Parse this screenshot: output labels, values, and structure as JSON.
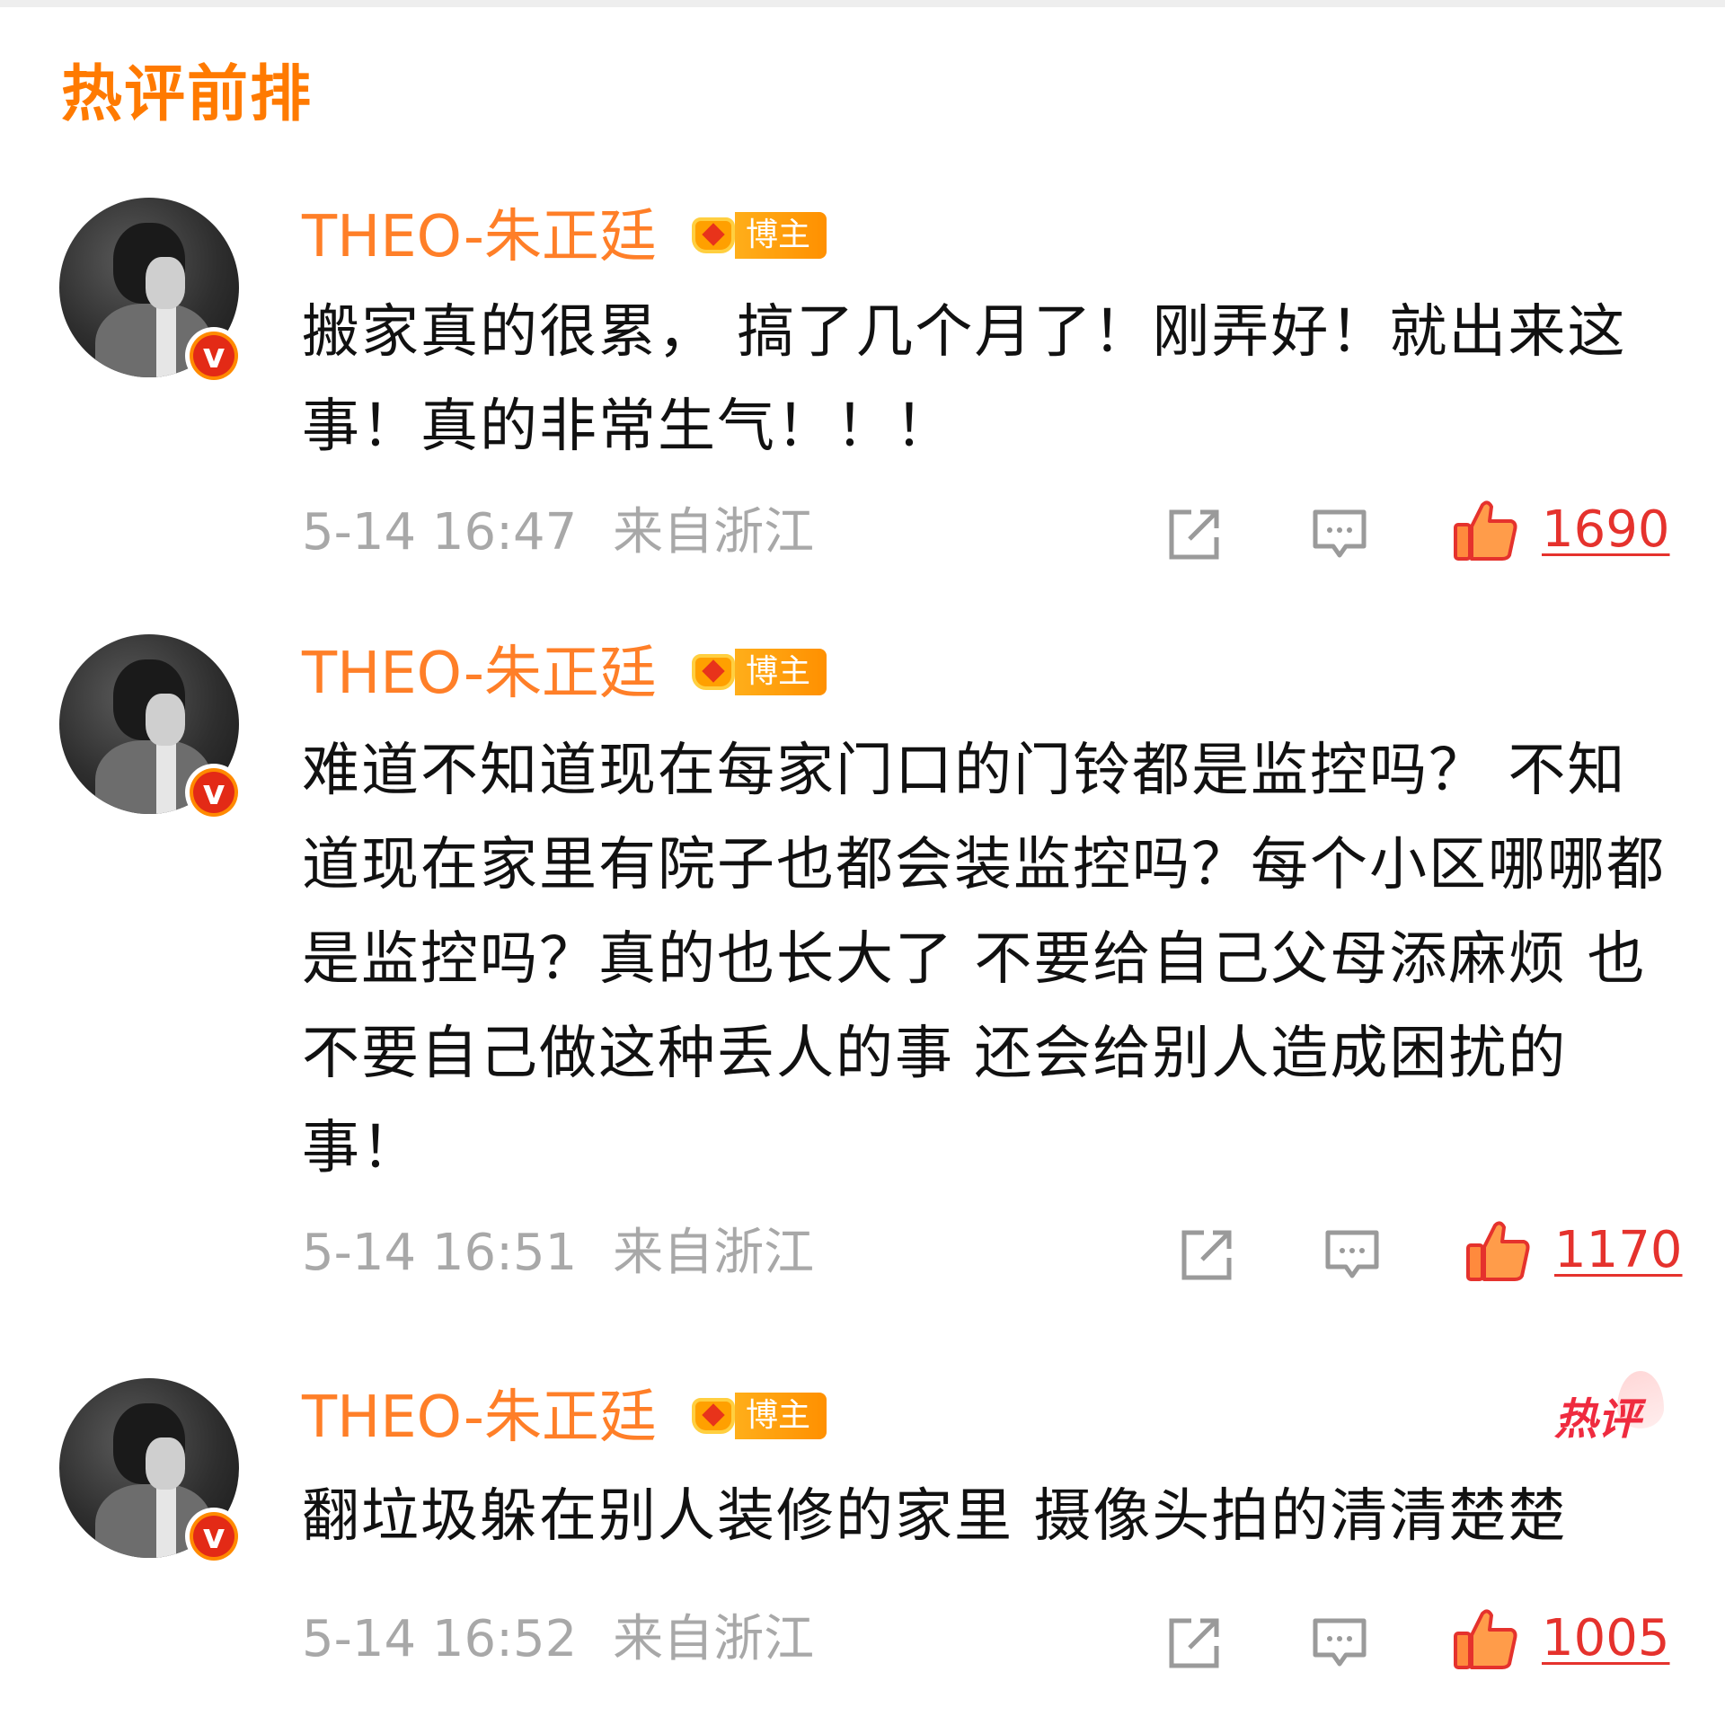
{
  "section": {
    "title": "热评前排"
  },
  "badge": {
    "blogger_label": "博主",
    "verified_label": "v"
  },
  "comments": [
    {
      "user": "THEO-朱正廷",
      "text": "搬家真的很累， 搞了几个月了！刚弄好！就出来这事！真的非常生气！！！",
      "time": "5-14 16:47",
      "location": "来自浙江",
      "likes": "1690",
      "hot_tag": ""
    },
    {
      "user": "THEO-朱正廷",
      "text": "难道不知道现在每家门口的门铃都是监控吗？ 不知道现在家里有院子也都会装监控吗？每个小区哪哪都是监控吗？真的也长大了 不要给自己父母添麻烦 也不要自己做这种丢人的事 还会给别人造成困扰的事！",
      "time": "5-14 16:51",
      "location": "来自浙江",
      "likes": "1170",
      "hot_tag": ""
    },
    {
      "user": "THEO-朱正廷",
      "text": "翻垃圾躲在别人装修的家里 摄像头拍的清清楚楚",
      "time": "5-14 16:52",
      "location": "来自浙江",
      "likes": "1005",
      "hot_tag": "热评"
    }
  ],
  "colors": {
    "accent": "#ff7a00",
    "username": "#ff7f28",
    "like_count": "#e5322d",
    "meta": "#a8a8a8",
    "hot_tag": "#ef2b3f"
  },
  "icons": {
    "share": "share-icon",
    "comment": "comment-icon",
    "like": "thumbs-up-icon"
  }
}
